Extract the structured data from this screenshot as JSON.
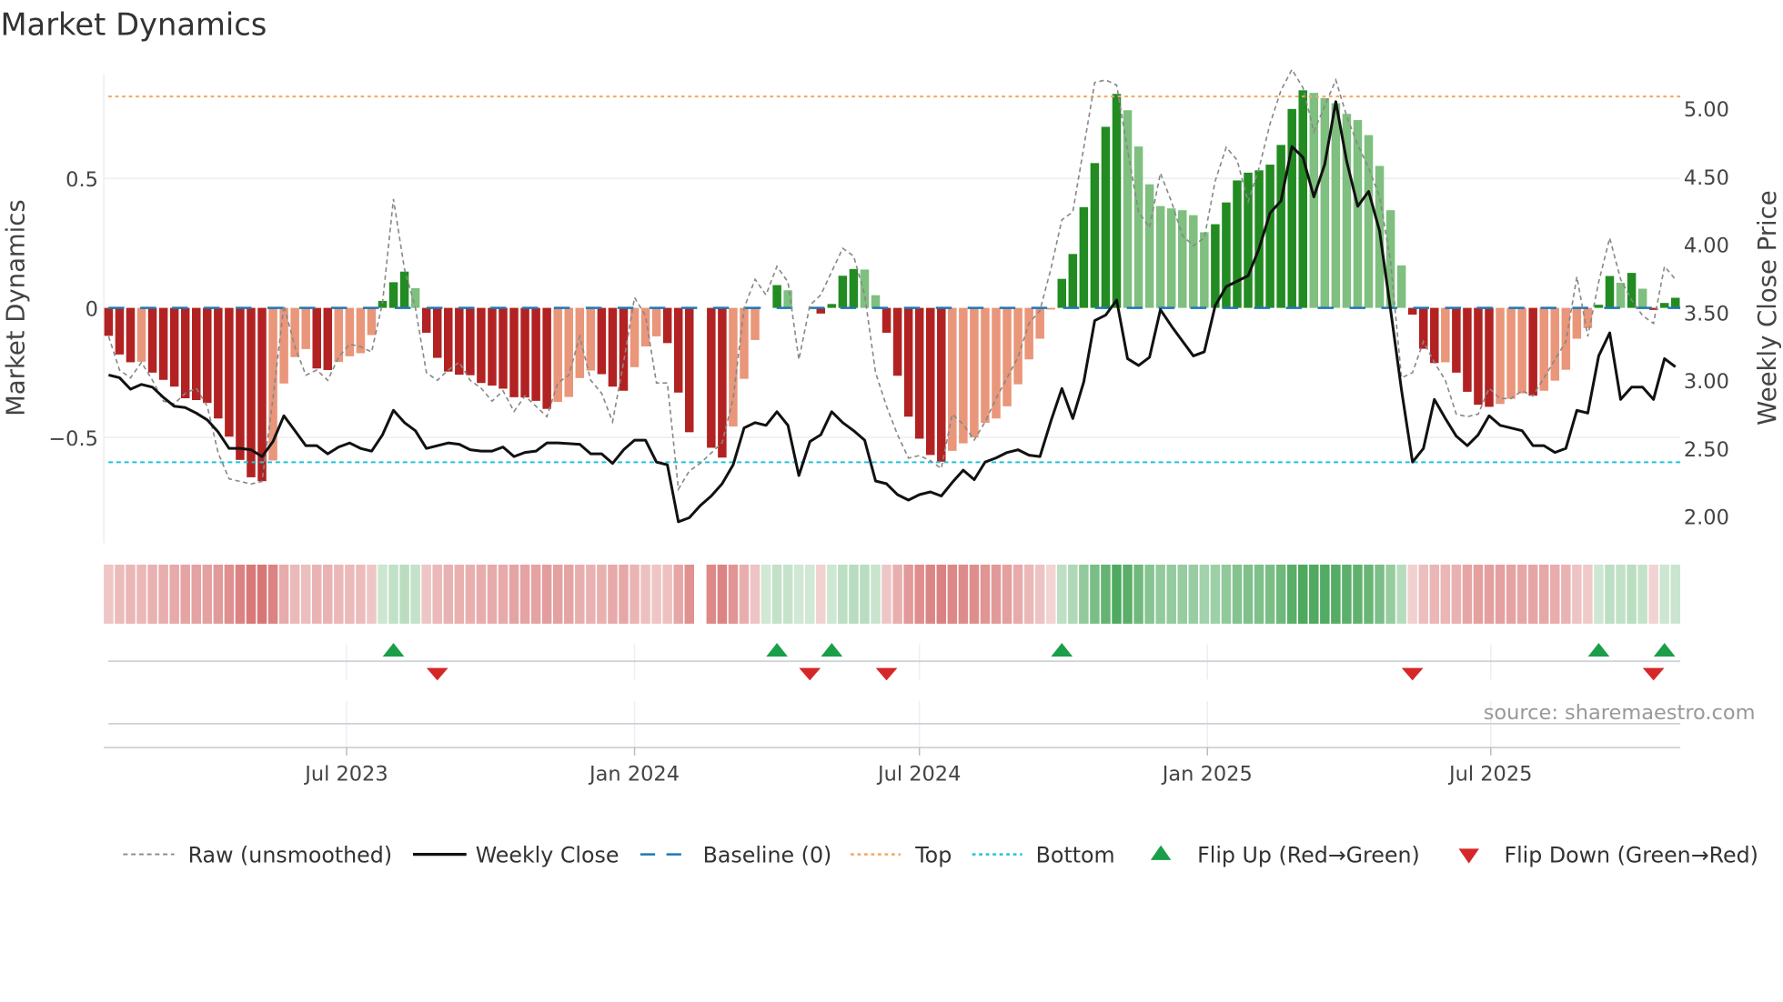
{
  "chart_data": {
    "type": "bar",
    "title": "Market Dynamics",
    "ylabel": "Market Dynamics",
    "y2label": "Weekly Close Price",
    "ylim": [
      -0.92,
      0.9
    ],
    "y2lim": [
      1.8,
      5.3
    ],
    "yticks": [
      {
        "value": 0.5,
        "label": "0.5"
      },
      {
        "value": 0,
        "label": "0"
      },
      {
        "value": -0.5,
        "label": "−0.5"
      }
    ],
    "y2ticks": [
      {
        "value": 5.0,
        "label": "5.00"
      },
      {
        "value": 4.5,
        "label": "4.50"
      },
      {
        "value": 4.0,
        "label": "4.00"
      },
      {
        "value": 3.5,
        "label": "3.50"
      },
      {
        "value": 3.0,
        "label": "3.00"
      },
      {
        "value": 2.5,
        "label": "2.50"
      },
      {
        "value": 2.0,
        "label": "2.00"
      }
    ],
    "xticks": [
      {
        "date": "2023-07-01",
        "label": "Jul 2023"
      },
      {
        "date": "2024-01-01",
        "label": "Jan 2024"
      },
      {
        "date": "2024-07-01",
        "label": "Jul 2024"
      },
      {
        "date": "2025-01-01",
        "label": "Jan 2025"
      },
      {
        "date": "2025-07-01",
        "label": "Jul 2025"
      }
    ],
    "start_date": "2023-01-30",
    "frequency": "weekly",
    "top": 0.816,
    "bottom": -0.596,
    "baseline": 0,
    "market_dynamics": [
      -0.108,
      -0.18,
      -0.21,
      -0.208,
      -0.25,
      -0.278,
      -0.304,
      -0.349,
      -0.356,
      -0.367,
      -0.427,
      -0.497,
      -0.587,
      -0.654,
      -0.669,
      -0.589,
      -0.292,
      -0.19,
      -0.159,
      -0.234,
      -0.24,
      -0.209,
      -0.187,
      -0.175,
      -0.105,
      0.027,
      0.099,
      0.14,
      0.076,
      -0.096,
      -0.193,
      -0.246,
      -0.258,
      -0.26,
      -0.29,
      -0.3,
      -0.312,
      -0.345,
      -0.346,
      -0.359,
      -0.39,
      -0.363,
      -0.344,
      -0.271,
      -0.242,
      -0.256,
      -0.304,
      -0.32,
      -0.229,
      -0.149,
      -0.11,
      -0.136,
      -0.327,
      -0.48,
      null,
      -0.54,
      -0.578,
      -0.458,
      -0.274,
      -0.124,
      0,
      0.088,
      0.068,
      0,
      0,
      -0.022,
      0.015,
      0.124,
      0.15,
      0.148,
      0.049,
      -0.096,
      -0.262,
      -0.42,
      -0.505,
      -0.568,
      -0.594,
      -0.552,
      -0.523,
      -0.5,
      -0.444,
      -0.427,
      -0.38,
      -0.295,
      -0.199,
      -0.119,
      -0.002,
      0.112,
      0.208,
      0.389,
      0.559,
      0.699,
      0.826,
      0.763,
      0.623,
      0.477,
      0.393,
      0.384,
      0.377,
      0.358,
      0.292,
      0.323,
      0.407,
      0.492,
      0.522,
      0.531,
      0.553,
      0.629,
      0.768,
      0.84,
      0.83,
      0.81,
      0.79,
      0.749,
      0.725,
      0.667,
      0.548,
      0.377,
      0.164,
      -0.026,
      -0.158,
      -0.213,
      -0.21,
      -0.25,
      -0.324,
      -0.374,
      -0.382,
      -0.371,
      -0.351,
      -0.33,
      -0.339,
      -0.32,
      -0.281,
      -0.239,
      -0.119,
      -0.078,
      0.012,
      0.123,
      0.097,
      0.135,
      0.074,
      -0.008,
      0.019,
      0.039
    ],
    "raw": [
      -0.11,
      -0.24,
      -0.27,
      -0.21,
      -0.28,
      -0.36,
      -0.37,
      -0.33,
      -0.31,
      -0.38,
      -0.56,
      -0.66,
      -0.67,
      -0.68,
      -0.67,
      -0.35,
      0.01,
      -0.15,
      -0.26,
      -0.24,
      -0.28,
      -0.19,
      -0.14,
      -0.15,
      -0.17,
      0.02,
      0.42,
      0.15,
      0.0,
      -0.25,
      -0.28,
      -0.24,
      -0.21,
      -0.28,
      -0.31,
      -0.36,
      -0.32,
      -0.4,
      -0.34,
      -0.38,
      -0.42,
      -0.29,
      -0.26,
      -0.11,
      -0.28,
      -0.33,
      -0.44,
      -0.21,
      0.04,
      -0.03,
      -0.29,
      -0.29,
      -0.7,
      -0.63,
      -0.6,
      -0.56,
      -0.52,
      -0.35,
      0.0,
      0.11,
      0.05,
      0.16,
      0.1,
      -0.2,
      0.01,
      0.05,
      0.14,
      0.23,
      0.2,
      0.05,
      -0.25,
      -0.38,
      -0.49,
      -0.58,
      -0.57,
      -0.59,
      -0.62,
      -0.41,
      -0.45,
      -0.51,
      -0.44,
      -0.35,
      -0.27,
      -0.19,
      -0.06,
      -0.01,
      0.15,
      0.34,
      0.37,
      0.62,
      0.87,
      0.88,
      0.86,
      0.61,
      0.37,
      0.31,
      0.52,
      0.41,
      0.28,
      0.24,
      0.27,
      0.49,
      0.62,
      0.57,
      0.41,
      0.54,
      0.71,
      0.84,
      0.92,
      0.85,
      0.68,
      0.78,
      0.88,
      0.74,
      0.63,
      0.54,
      0.43,
      0.18,
      -0.27,
      -0.25,
      -0.13,
      -0.21,
      -0.28,
      -0.41,
      -0.42,
      -0.41,
      -0.31,
      -0.35,
      -0.35,
      -0.32,
      -0.34,
      -0.27,
      -0.2,
      -0.13,
      0.12,
      -0.11,
      0.1,
      0.27,
      0.11,
      0.03,
      -0.03,
      -0.06,
      0.16,
      0.11
    ],
    "weekly_close": [
      3.04,
      3.02,
      2.935,
      2.97,
      2.95,
      2.875,
      2.81,
      2.8,
      2.76,
      2.71,
      2.62,
      2.5,
      2.5,
      2.49,
      2.44,
      2.55,
      2.74,
      2.63,
      2.52,
      2.52,
      2.46,
      2.51,
      2.54,
      2.5,
      2.48,
      2.6,
      2.78,
      2.69,
      2.63,
      2.5,
      2.52,
      2.54,
      2.53,
      2.49,
      2.48,
      2.48,
      2.51,
      2.44,
      2.47,
      2.48,
      2.54,
      2.54,
      2.535,
      2.53,
      2.46,
      2.46,
      2.39,
      2.49,
      2.56,
      2.56,
      2.4,
      2.38,
      1.96,
      1.99,
      2.08,
      2.15,
      2.24,
      2.38,
      2.65,
      2.69,
      2.67,
      2.77,
      2.67,
      2.3,
      2.55,
      2.6,
      2.77,
      2.69,
      2.63,
      2.56,
      2.26,
      2.24,
      2.16,
      2.12,
      2.16,
      2.18,
      2.15,
      2.25,
      2.34,
      2.27,
      2.4,
      2.43,
      2.47,
      2.49,
      2.45,
      2.44,
      2.7,
      2.94,
      2.72,
      2.99,
      3.44,
      3.48,
      3.59,
      3.16,
      3.11,
      3.17,
      3.52,
      3.4,
      3.29,
      3.18,
      3.21,
      3.55,
      3.69,
      3.73,
      3.77,
      3.97,
      4.23,
      4.32,
      4.72,
      4.64,
      4.35,
      4.59,
      5.05,
      4.61,
      4.28,
      4.39,
      4.1,
      3.52,
      2.93,
      2.4,
      2.5,
      2.86,
      2.72,
      2.59,
      2.52,
      2.6,
      2.74,
      2.67,
      2.65,
      2.63,
      2.52,
      2.52,
      2.47,
      2.5,
      2.78,
      2.76,
      3.18,
      3.35,
      2.86,
      2.95,
      2.95,
      2.86,
      3.16,
      3.1
    ],
    "flips_up": [
      "2023-07-31",
      "2024-04-01",
      "2024-05-06",
      "2024-09-30",
      "2025-09-08",
      "2025-10-20"
    ],
    "flips_down": [
      "2023-08-28",
      "2024-04-22",
      "2024-06-10",
      "2025-05-12",
      "2025-10-13"
    ],
    "legend": {
      "placement": "bottom",
      "raw": "Raw (unsmoothed)",
      "close": "Weekly Close",
      "baseline": "Baseline (0)",
      "top": "Top",
      "bottom": "Bottom",
      "flip_up": "Flip Up (Red→Green)",
      "flip_down": "Flip Down (Green→Red)"
    },
    "source": "source: sharemaestro.com",
    "colors": {
      "neg_strengthening": "#b22222",
      "neg_weakening": "#e9967a",
      "pos_strengthening": "#228b22",
      "pos_weakening": "#7fbf7f",
      "raw": "#888888",
      "close": "#111111",
      "baseline": "#1f77b4",
      "top": "#f0a860",
      "bottom": "#22c3d6",
      "flip_up": "#1a9e4a",
      "flip_down": "#d62728"
    }
  }
}
